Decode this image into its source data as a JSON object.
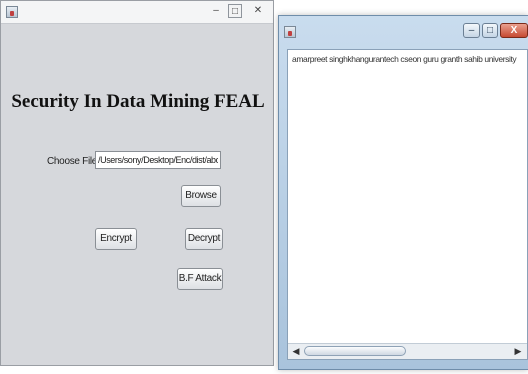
{
  "left_window": {
    "heading": "Security In Data Mining FEAL",
    "choose_file_label": "Choose File",
    "file_path": "/Users/sony/Desktop/Enc/dist/abc.txt",
    "browse_label": "Browse",
    "encrypt_label": "Encrypt",
    "decrypt_label": "Decrypt",
    "attack_label": "B.F Attack",
    "controls": {
      "minimize": "–",
      "maximize": "□",
      "close": "✕"
    }
  },
  "right_window": {
    "text_content": "amarpreet singhkhangurantech cseon guru granth sahib university",
    "controls": {
      "minimize": "–",
      "maximize": "□",
      "close": "X"
    },
    "scroll_left": "◀",
    "scroll_right": "▶"
  },
  "colors": {
    "swing_bg": "#d6d8dc",
    "win7_frame": "#a9c3dc",
    "close_red": "#c64a32"
  }
}
